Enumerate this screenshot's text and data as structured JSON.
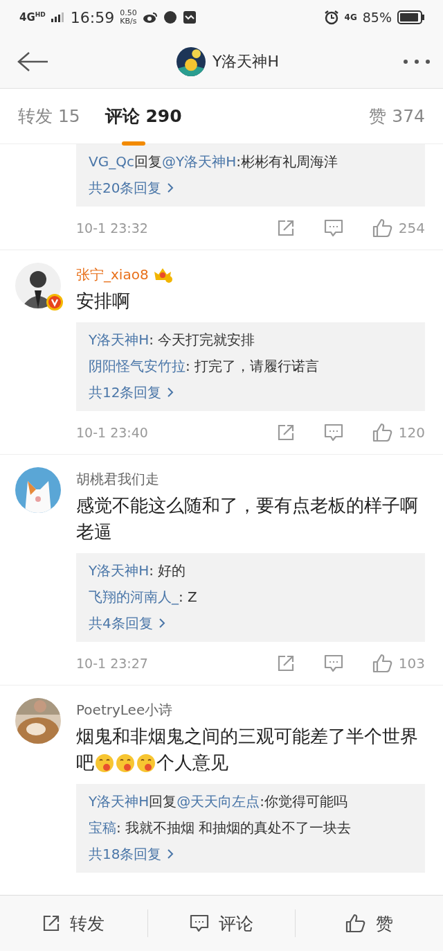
{
  "status_bar": {
    "network": "4G$^{HD}$",
    "time": "16:59",
    "speed": "0.50",
    "speed_unit": "KB/s",
    "network_right": "4G",
    "battery": "85%"
  },
  "header": {
    "title": "Y洛天神H",
    "avatar": {
      "kind": "picture"
    }
  },
  "tabs": [
    {
      "label": "转发",
      "count": "15",
      "selected": false
    },
    {
      "label": "评论",
      "count": "290",
      "selected": true
    },
    {
      "label": "赞",
      "count": "374",
      "selected": false
    }
  ],
  "comments": [
    {
      "replies": [
        [
          {
            "text": "VG_Qc",
            "kind": "user"
          },
          {
            "text": "回复",
            "kind": "text"
          },
          {
            "text": "@Y洛天神H",
            "kind": "user"
          },
          {
            "text": ":彬彬有礼周海洋",
            "kind": "text"
          }
        ]
      ],
      "more": "共20条回复",
      "time": "10-1 23:32",
      "likes": "254"
    },
    {
      "name": "张宁_xiao8",
      "vip": true,
      "verified": true,
      "avatar": {
        "kind": "picture"
      },
      "body": [
        {
          "kind": "text",
          "text": "安排啊"
        }
      ],
      "replies": [
        [
          {
            "text": "Y洛天神H",
            "kind": "user"
          },
          {
            "text": ": 今天打完就安排",
            "kind": "text"
          }
        ],
        [
          {
            "text": "阴阳怪气安竹拉",
            "kind": "user"
          },
          {
            "text": ": 打完了，请履行诺言",
            "kind": "text"
          }
        ]
      ],
      "more": "共12条回复",
      "time": "10-1 23:40",
      "likes": "120"
    },
    {
      "name": "胡桃君我们走",
      "vip": false,
      "verified": false,
      "avatar": {
        "kind": "picture"
      },
      "body": [
        {
          "kind": "text",
          "text": "感觉不能这么随和了，要有点老板的样子啊老逼"
        }
      ],
      "replies": [
        [
          {
            "text": "Y洛天神H",
            "kind": "user"
          },
          {
            "text": ": 好的",
            "kind": "text"
          }
        ],
        [
          {
            "text": "飞翔的河南人_",
            "kind": "user"
          },
          {
            "text": ": Z",
            "kind": "text"
          }
        ]
      ],
      "more": "共4条回复",
      "time": "10-1 23:27",
      "likes": "103"
    },
    {
      "name": "PoetryLee小诗",
      "vip": false,
      "verified": false,
      "avatar": {
        "kind": "picture"
      },
      "body": [
        {
          "kind": "text",
          "text": "烟鬼和非烟鬼之间的三观可能差了半个世界吧"
        },
        {
          "kind": "emoji"
        },
        {
          "kind": "emoji"
        },
        {
          "kind": "emoji"
        },
        {
          "kind": "text",
          "text": "个人意见"
        }
      ],
      "replies": [
        [
          {
            "text": "Y洛天神H",
            "kind": "user"
          },
          {
            "text": "回复",
            "kind": "text"
          },
          {
            "text": "@天天向左点",
            "kind": "user"
          },
          {
            "text": ":你觉得可能吗",
            "kind": "text"
          }
        ],
        [
          {
            "text": "宝稿",
            "kind": "user"
          },
          {
            "text": ": 我就不抽烟 和抽烟的真处不了一块去",
            "kind": "text"
          }
        ]
      ],
      "more": "共18条回复"
    }
  ],
  "bottom_bar": [
    {
      "label": "转发",
      "kind": "share"
    },
    {
      "label": "评论",
      "kind": "comment"
    },
    {
      "label": "赞",
      "kind": "like"
    }
  ]
}
